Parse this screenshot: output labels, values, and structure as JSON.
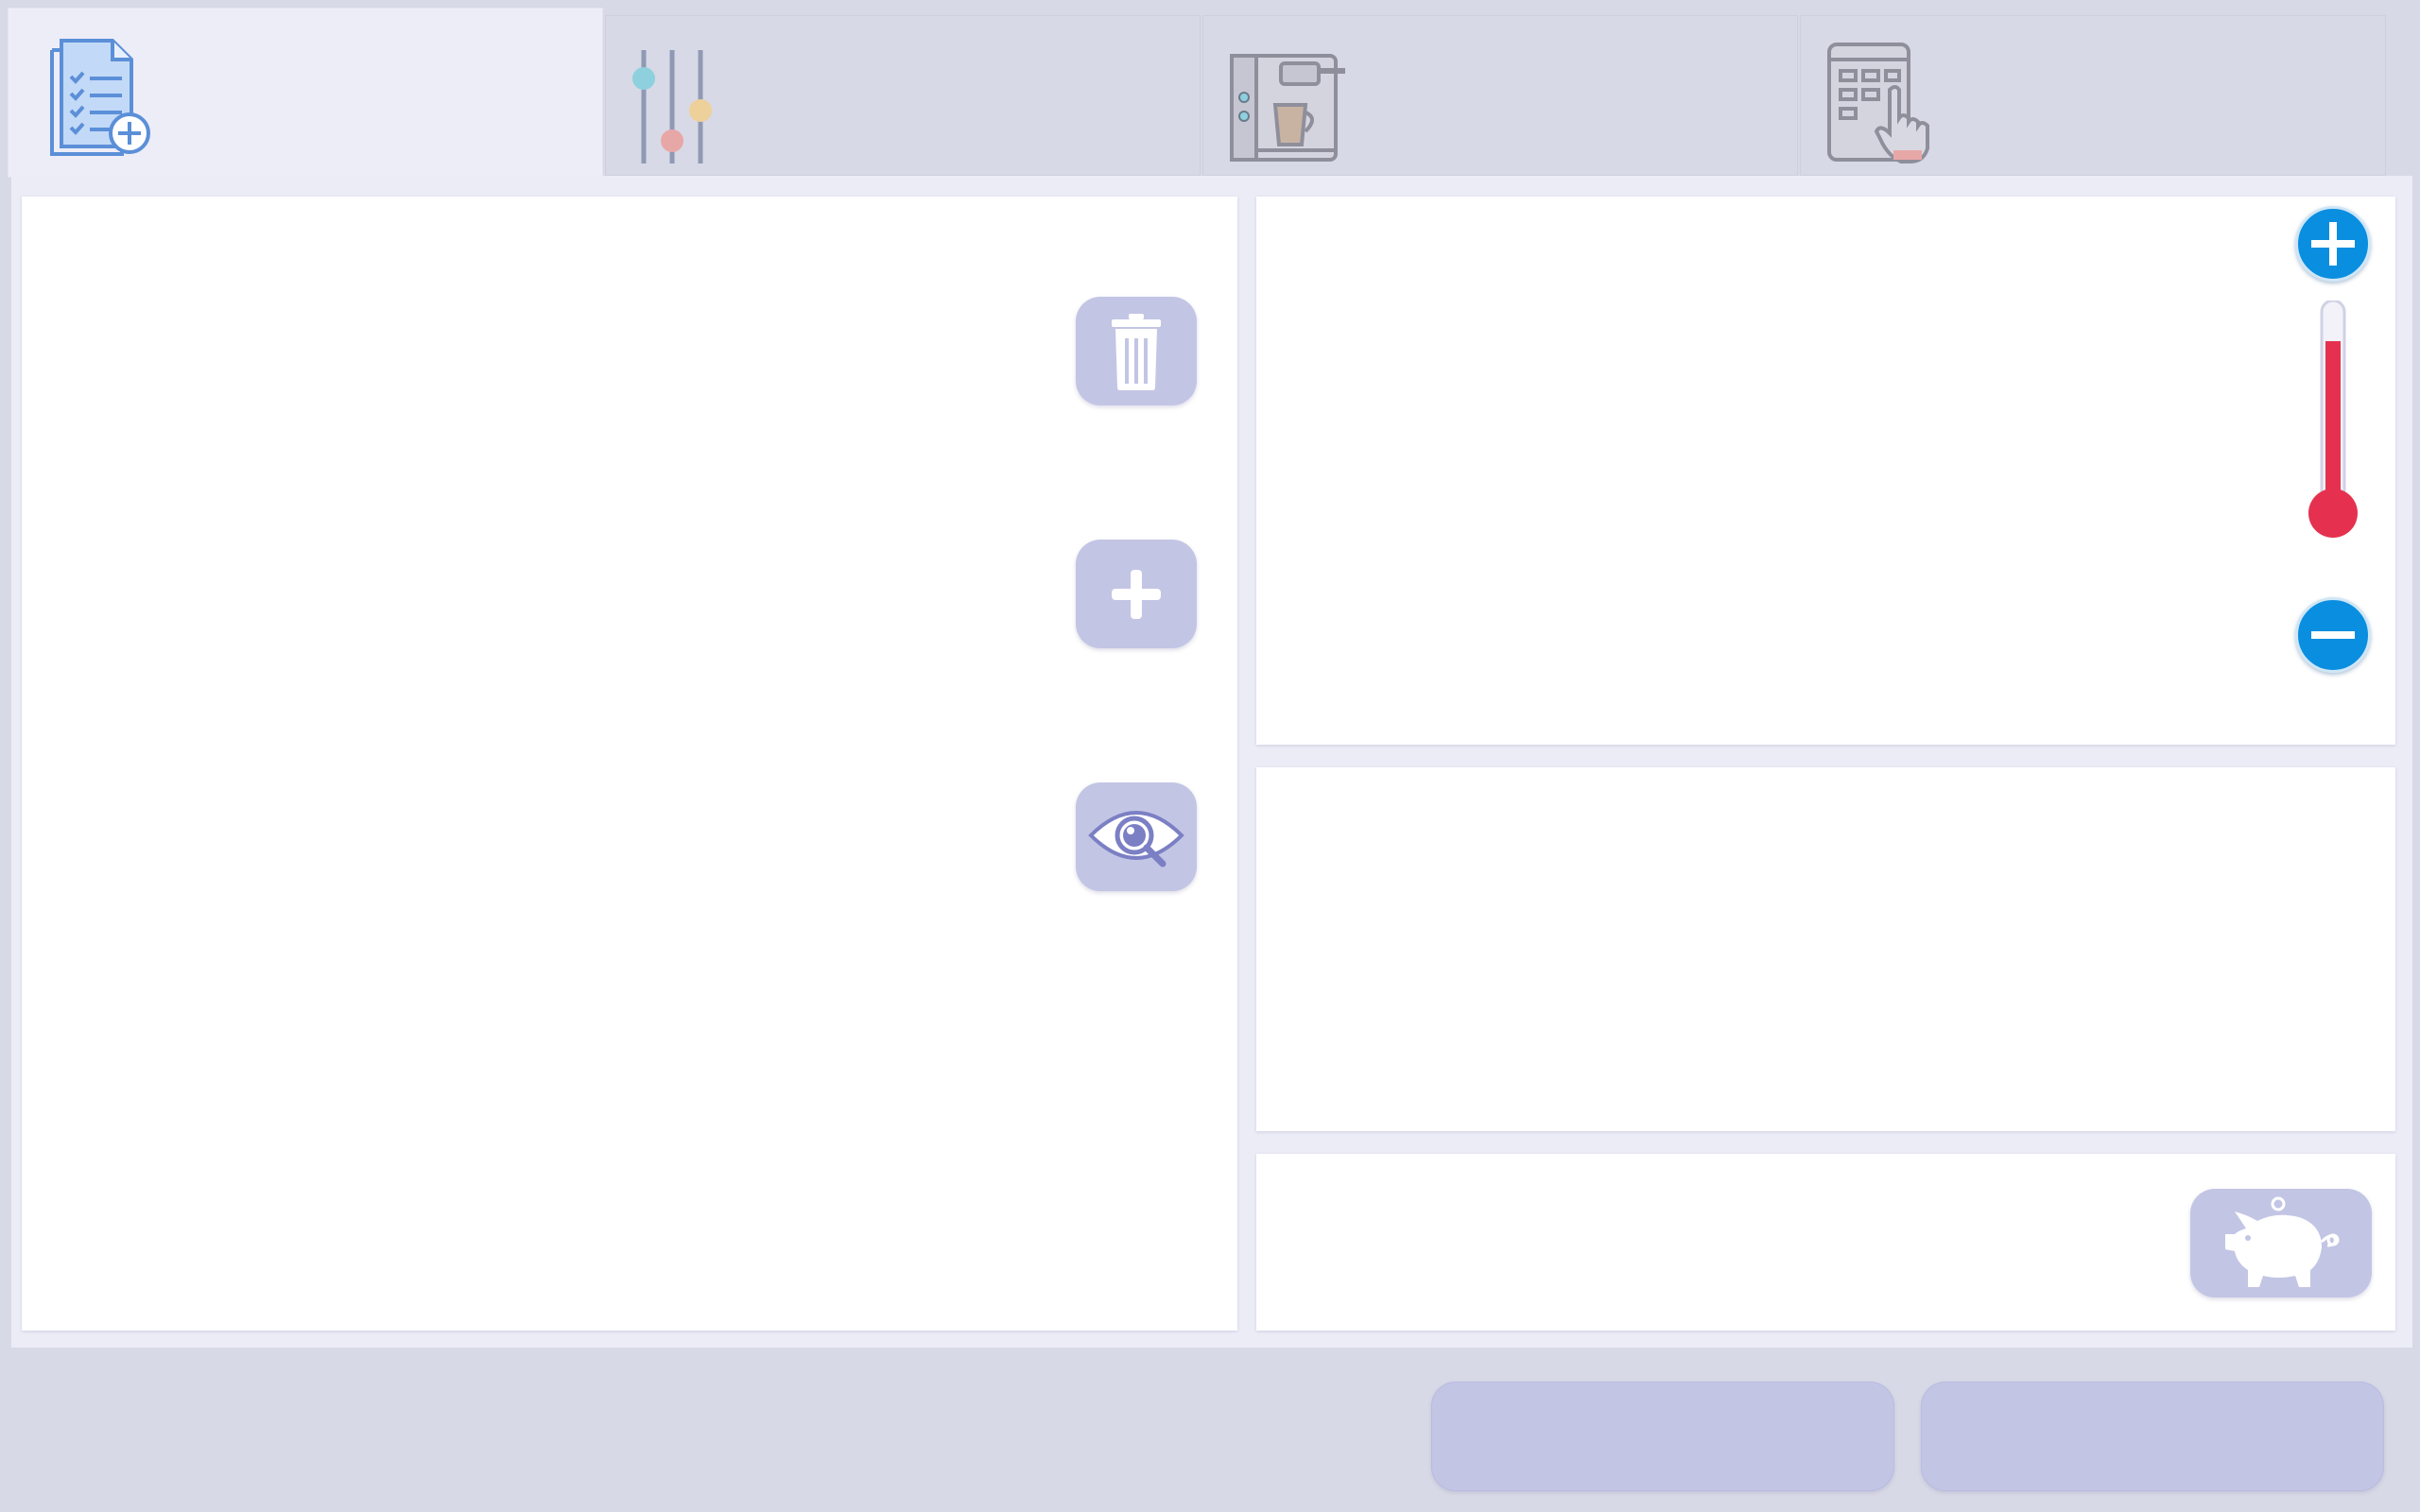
{
  "tabs": [
    {
      "icon": "checklist-add-icon",
      "active": true
    },
    {
      "icon": "sliders-icon",
      "active": false
    },
    {
      "icon": "coffee-machine-icon",
      "active": false
    },
    {
      "icon": "touch-menu-icon",
      "active": false
    }
  ],
  "left_panel": {
    "buttons": [
      {
        "icon": "trash-icon"
      },
      {
        "icon": "plus-icon"
      },
      {
        "icon": "eye-search-icon"
      }
    ]
  },
  "temperature": {
    "level": 0.85,
    "increase_icon": "plus-circle-icon",
    "decrease_icon": "minus-circle-icon",
    "fill_color": "#e5314f"
  },
  "footer": {
    "savings_icon": "piggy-bank-icon",
    "buttons": [
      {
        "label": ""
      },
      {
        "label": ""
      }
    ]
  },
  "colors": {
    "background": "#d8d9e6",
    "active_tab": "#ededf8",
    "button": "#c3c5e5",
    "accent_blue": "#0a8ee0"
  }
}
